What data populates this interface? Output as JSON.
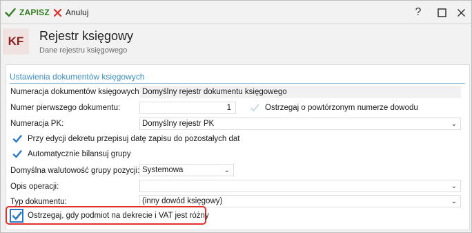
{
  "toolbar": {
    "save_label": "ZAPISZ",
    "cancel_label": "Anuluj",
    "help_label": "?",
    "maximize_glyph": "☐",
    "close_glyph": "✕"
  },
  "header": {
    "avatar_text": "KF",
    "title": "Rejestr księgowy",
    "subtitle": "Dane rejestru księgowego"
  },
  "section": {
    "title": "Ustawienia dokumentów księgowych"
  },
  "form": {
    "numeracja_label": "Numeracja dokumentów księgowych:",
    "numeracja_value": "Domyślny rejestr dokumentu księgowego",
    "numer_pierwszego_label": "Numer pierwszego dokumentu:",
    "numer_pierwszego_value": "1",
    "ostrzegaj_label": "Ostrzegaj o powtórzonym numerze dowodu",
    "ostrzegaj_checked": false,
    "numeracja_pk_label": "Numeracja PK:",
    "numeracja_pk_value": "Domyślny rejestr PK",
    "przy_edycji_label": "Przy edycji dekretu przepisuj datę zapisu do pozostałych dat",
    "przy_edycji_checked": true,
    "automatycznie_label": "Automatycznie bilansuj grupy",
    "automatycznie_checked": true,
    "waluta_label": "Domyślna walutowość grupy pozycji:",
    "waluta_value": "Systemowa",
    "opis_label": "Opis operacji:",
    "opis_value": "",
    "typ_label": "Typ dokumentu:",
    "typ_value": "(inny dowód księgowy)",
    "ostrzegaj_vat_label": "Ostrzegaj, gdy podmiot na dekrecie i VAT jest różny",
    "ostrzegaj_vat_checked": true
  },
  "colors": {
    "save_green": "#2e7d1e",
    "cancel_red": "#d9302a",
    "accent_blue": "#3f8fc0",
    "highlight_red": "#e0302a",
    "avatar_bg": "#efe2e0",
    "avatar_fg": "#8b1f1f"
  },
  "icons": {
    "save": "check-icon",
    "cancel": "x-icon",
    "dropdown": "chevron-down-icon"
  }
}
